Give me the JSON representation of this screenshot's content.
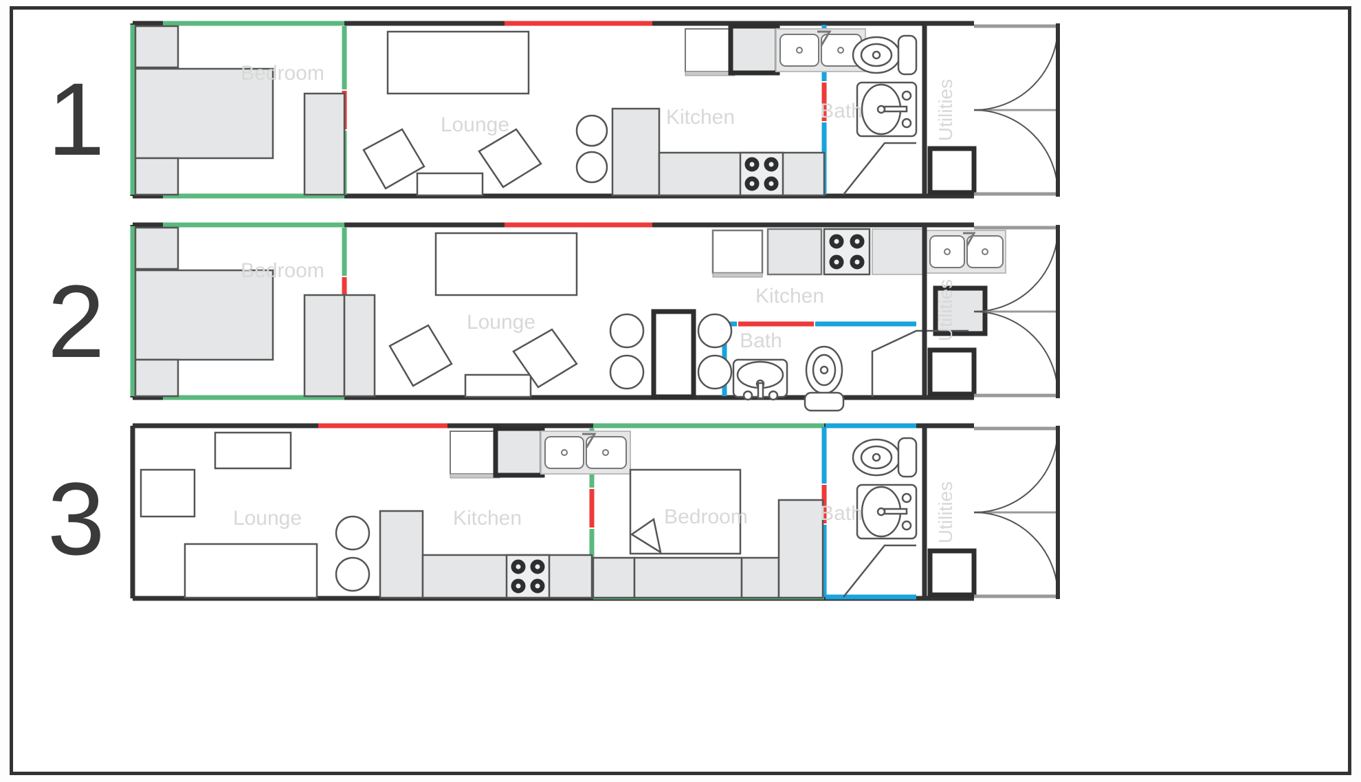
{
  "document": {
    "type": "floor-plan-comparison",
    "title": "",
    "variant_count": 3,
    "description": "Three tiny-home / trailer interior layout variants shown in plan view"
  },
  "legend_colors": {
    "wall": "#333333",
    "accent_green": "#5bb87f",
    "accent_red": "#ee3a3a",
    "accent_blue": "#1aa3dc",
    "fixture_fill": "#e4e6e7",
    "fixture_stroke": "#555555",
    "label_text": "#d8d8d8",
    "number_text": "#3a3a3a",
    "background": "#ffffff"
  },
  "plans": [
    {
      "number": "1",
      "rooms": [
        {
          "name": "Bedroom",
          "label": "Bedroom",
          "orientation": "horizontal",
          "accent": "accent_green"
        },
        {
          "name": "Lounge",
          "label": "Lounge",
          "orientation": "horizontal",
          "accent": "accent_red"
        },
        {
          "name": "Kitchen",
          "label": "Kitchen",
          "orientation": "horizontal",
          "accent": "accent_red"
        },
        {
          "name": "Bath",
          "label": "Bath",
          "orientation": "horizontal",
          "accent": "accent_blue"
        },
        {
          "name": "Utilities",
          "label": "Utilities",
          "orientation": "vertical",
          "accent": "wall"
        }
      ],
      "order": [
        "Bedroom",
        "Lounge",
        "Kitchen",
        "Bath",
        "Utilities"
      ],
      "fixtures": [
        "bed",
        "nightstand",
        "wardrobe",
        "sofa",
        "armchair",
        "armchair",
        "coffee-table",
        "stool",
        "stool",
        "counter",
        "refrigerator",
        "dishwasher",
        "double-sink",
        "cooktop-4-burner",
        "toilet",
        "vanity-sink",
        "shower",
        "water-heater",
        "rear-doors"
      ]
    },
    {
      "number": "2",
      "rooms": [
        {
          "name": "Bedroom",
          "label": "Bedroom",
          "orientation": "horizontal",
          "accent": "accent_green"
        },
        {
          "name": "Lounge",
          "label": "Lounge",
          "orientation": "horizontal",
          "accent": "accent_red"
        },
        {
          "name": "Kitchen",
          "label": "Kitchen",
          "orientation": "horizontal",
          "accent": "accent_red"
        },
        {
          "name": "Bath",
          "label": "Bath",
          "orientation": "horizontal",
          "accent": "accent_blue"
        },
        {
          "name": "Utilities",
          "label": "Utilities",
          "orientation": "vertical",
          "accent": "wall"
        }
      ],
      "order": [
        "Bedroom",
        "Lounge",
        "Kitchen",
        "Bath",
        "Utilities"
      ],
      "fixtures": [
        "bed",
        "nightstand",
        "wardrobe",
        "wardrobe",
        "sofa",
        "armchair",
        "armchair",
        "coffee-table",
        "stool",
        "stool",
        "stool",
        "stool",
        "partition",
        "refrigerator",
        "counter",
        "cooktop-4-burner",
        "counter",
        "double-sink",
        "vanity-sink",
        "toilet",
        "shower",
        "water-heater",
        "rear-doors"
      ]
    },
    {
      "number": "3",
      "rooms": [
        {
          "name": "Lounge",
          "label": "Lounge",
          "orientation": "horizontal",
          "accent": "accent_red"
        },
        {
          "name": "Kitchen",
          "label": "Kitchen",
          "orientation": "horizontal",
          "accent": "accent_red"
        },
        {
          "name": "Bedroom",
          "label": "Bedroom",
          "orientation": "horizontal",
          "accent": "accent_green"
        },
        {
          "name": "Bath",
          "label": "Bath",
          "orientation": "horizontal",
          "accent": "accent_blue"
        },
        {
          "name": "Utilities",
          "label": "Utilities",
          "orientation": "vertical",
          "accent": "wall"
        }
      ],
      "order": [
        "Lounge",
        "Kitchen",
        "Bedroom",
        "Bath",
        "Utilities"
      ],
      "fixtures": [
        "sofa",
        "side-table",
        "coffee-table",
        "stool",
        "stool",
        "counter",
        "refrigerator",
        "dishwasher",
        "double-sink",
        "cooktop-4-burner",
        "bed",
        "pillow",
        "wardrobe",
        "storage",
        "toilet",
        "vanity-sink",
        "shower",
        "water-heater",
        "rear-doors"
      ]
    }
  ]
}
